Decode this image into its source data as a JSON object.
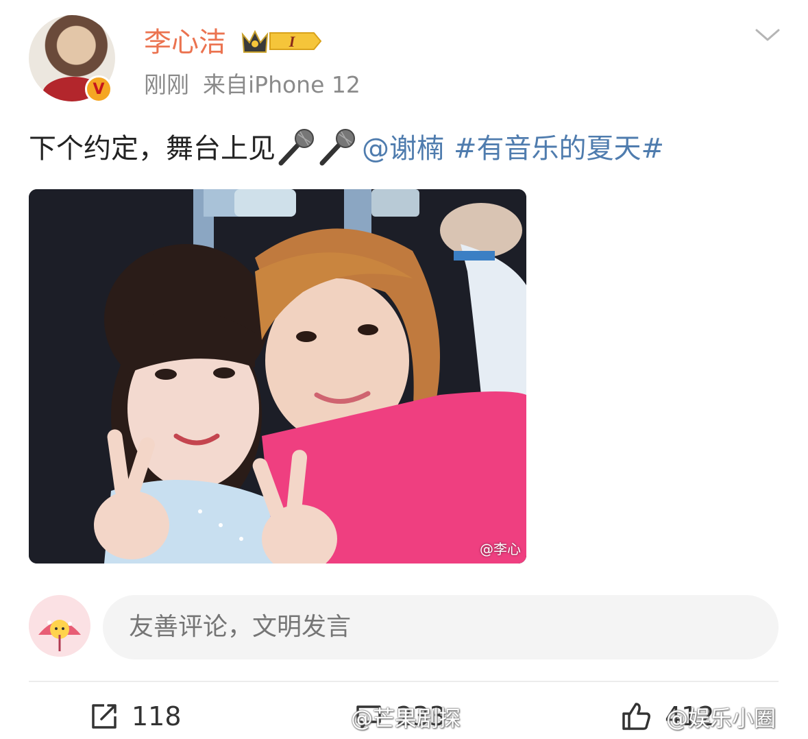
{
  "post": {
    "author": "李心洁",
    "vip_level": "I",
    "time": "刚刚",
    "source": "来自iPhone 12",
    "text_main": "下个约定，舞台上见",
    "mention": "@谢楠",
    "hashtag": "#有音乐的夏天#",
    "image_watermark": "@李心"
  },
  "comment": {
    "placeholder": "友善评论，文明发言"
  },
  "actions": {
    "repost_count": "118",
    "comment_count": "233",
    "like_count": "412"
  },
  "watermarks": {
    "left": "@芒果剧探",
    "right": "@娱乐小圈"
  },
  "colors": {
    "username": "#eb7350",
    "link": "#4f7cae",
    "meta": "#8a8a8a",
    "input_bg": "#f4f4f4",
    "shirt_pink": "#ef3f80"
  },
  "icons": {
    "more": "chevron-down-icon",
    "verified": "verified-v-icon",
    "mic": "microphone-icon",
    "repost": "repost-icon",
    "comment": "comment-icon",
    "like": "thumbs-up-icon"
  }
}
